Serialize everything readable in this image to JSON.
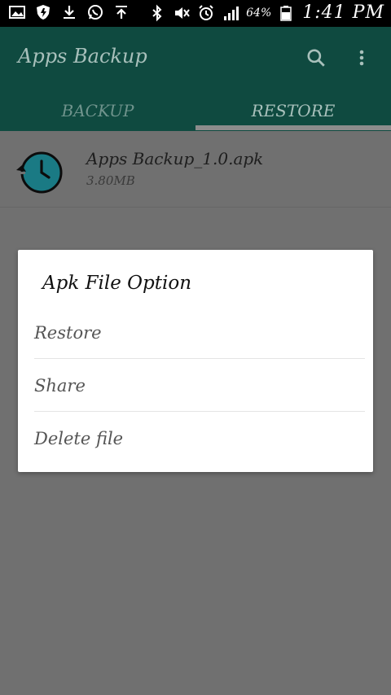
{
  "status_bar": {
    "left_icons": [
      "gallery-icon",
      "shield-icon",
      "download-icon",
      "whatsapp-icon",
      "upload-icon"
    ],
    "right_icons": [
      "bluetooth-icon",
      "mute-icon",
      "alarm-icon",
      "signal-icon",
      "battery-icon"
    ],
    "battery": "64%",
    "time": "1:41 PM"
  },
  "app": {
    "title": "Apps Backup",
    "colors": {
      "primary": "#0f4a40",
      "accent": "#1a7a84",
      "background": "#707070"
    }
  },
  "tabs": [
    {
      "label": "BACKUP",
      "selected": false
    },
    {
      "label": "RESTORE",
      "selected": true
    }
  ],
  "files": [
    {
      "name": "Apps Backup_1.0.apk",
      "size": "3.80MB",
      "icon": "restore-clock-icon"
    }
  ],
  "dialog": {
    "title": "Apk File Option",
    "options": [
      {
        "label": "Restore"
      },
      {
        "label": "Share"
      },
      {
        "label": "Delete file"
      }
    ]
  }
}
